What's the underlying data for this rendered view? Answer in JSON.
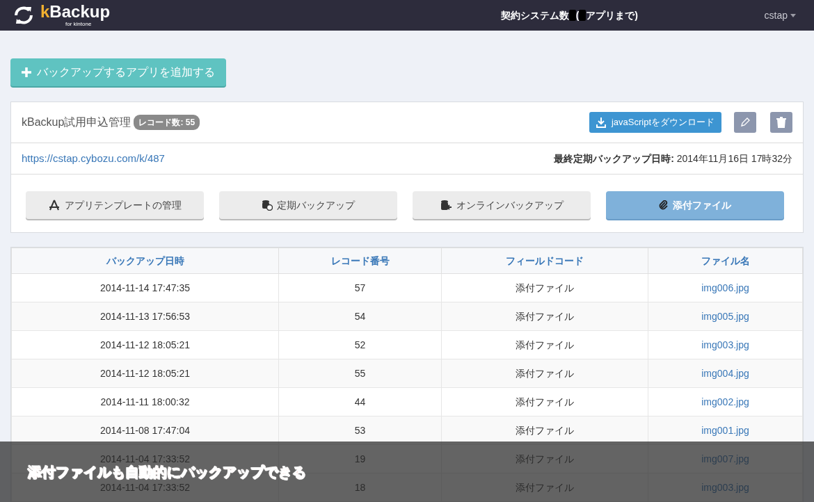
{
  "navbar": {
    "logo_accent": "k",
    "logo_main": "Backup",
    "logo_sub": "for kintone",
    "contract_label": "契約システム数",
    "contract_paren": "(",
    "contract_suffix": "アプリまで)",
    "user": "cstap"
  },
  "add_button": {
    "label": "バックアップするアプリを追加する"
  },
  "app": {
    "name": "kBackup試用申込管理",
    "badge": "レコード数: 55",
    "download_button": "javaScriptをダウンロード",
    "url": "https://cstap.cybozu.com/k/487",
    "last_backup_label": "最終定期バックアップ日時:",
    "last_backup_value": "2014年11月16日 17時32分",
    "tabs": [
      {
        "label": "アプリテンプレートの管理",
        "kind": "template",
        "selected": false
      },
      {
        "label": "定期バックアップ",
        "kind": "schedule",
        "selected": false
      },
      {
        "label": "オンラインバックアップ",
        "kind": "online",
        "selected": false
      },
      {
        "label": "添付ファイル",
        "kind": "attachment",
        "selected": true
      }
    ]
  },
  "table": {
    "columns": [
      "バックアップ日時",
      "レコード番号",
      "フィールドコード",
      "ファイル名"
    ],
    "rows": [
      [
        "2014-11-14 17:47:35",
        "57",
        "添付ファイル",
        "img006.jpg"
      ],
      [
        "2014-11-13 17:56:53",
        "54",
        "添付ファイル",
        "img005.jpg"
      ],
      [
        "2014-11-12 18:05:21",
        "52",
        "添付ファイル",
        "img003.jpg"
      ],
      [
        "2014-11-12 18:05:21",
        "55",
        "添付ファイル",
        "img004.jpg"
      ],
      [
        "2014-11-11 18:00:32",
        "44",
        "添付ファイル",
        "img002.jpg"
      ],
      [
        "2014-11-08 17:47:04",
        "53",
        "添付ファイル",
        "img001.jpg"
      ],
      [
        "2014-11-04 17:33:52",
        "19",
        "添付ファイル",
        "img007.jpg"
      ],
      [
        "2014-11-04 17:33:52",
        "18",
        "添付ファイル",
        "img003.jpg"
      ]
    ]
  },
  "caption": "添付ファイルも自動的にバックアップできる"
}
